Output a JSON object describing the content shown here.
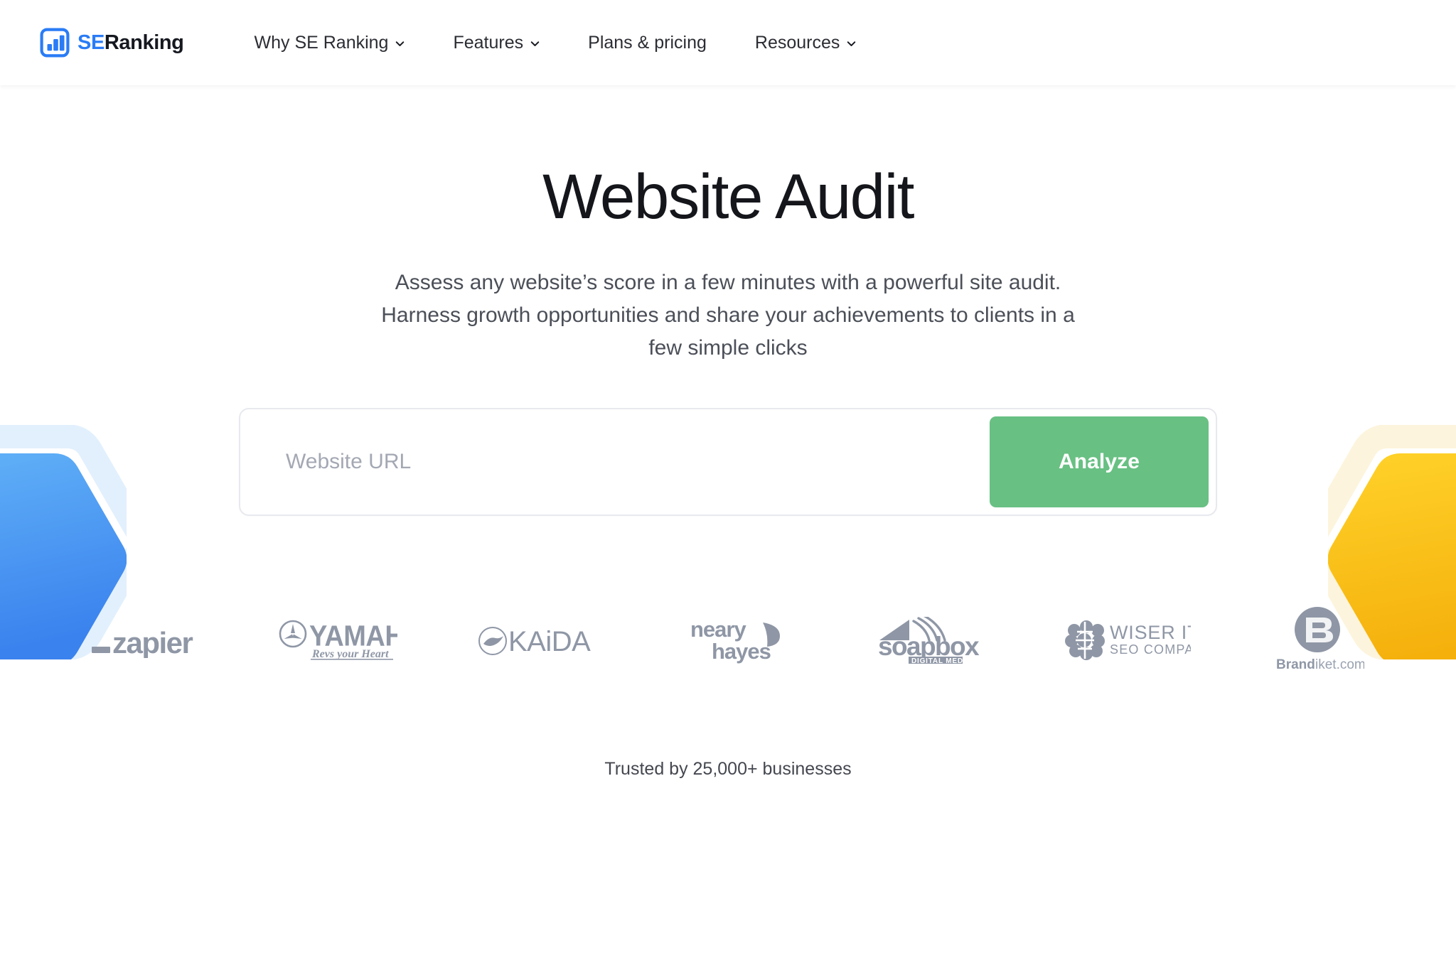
{
  "header": {
    "brand": {
      "icon": "bar-chart-logo-icon",
      "text_primary": "SE",
      "text_secondary": "Ranking",
      "accent_color": "#2a7cf6",
      "text_color": "#15181f"
    },
    "nav": [
      {
        "label": "Why SE Ranking",
        "has_dropdown": true,
        "icon": "chevron-down-icon"
      },
      {
        "label": "Features",
        "has_dropdown": true,
        "icon": "chevron-down-icon"
      },
      {
        "label": "Plans & pricing",
        "has_dropdown": false,
        "icon": ""
      },
      {
        "label": "Resources",
        "has_dropdown": true,
        "icon": "chevron-down-icon"
      }
    ]
  },
  "hero": {
    "title": "Website Audit",
    "subtitle": "Assess any website’s score in a few minutes with a powerful site audit. Harness growth opportunities and share your achievements to clients in a few simple clicks"
  },
  "search": {
    "placeholder": "Website URL",
    "value": "",
    "button_label": "Analyze",
    "button_color": "#68c083",
    "border_color": "#e8e9ef"
  },
  "logos": [
    {
      "name": "zapier",
      "label": "_zapier"
    },
    {
      "name": "yamaha",
      "label": "YAMAHA",
      "tagline": "Revs your Heart"
    },
    {
      "name": "kaida",
      "label": "KAiDA"
    },
    {
      "name": "neary-hayes",
      "label_top": "neary",
      "label_bottom": "hayes"
    },
    {
      "name": "soapbox",
      "label": "soapbox",
      "tagline": "DIGITAL MEDIA"
    },
    {
      "name": "wiser-it",
      "label": "WISER IT",
      "tagline": "SEO COMPANY"
    },
    {
      "name": "brandiket",
      "label_bold": "Brand",
      "label_rest": "iket.com"
    }
  ],
  "trusted": {
    "text": "Trusted by 25,000+ businesses"
  },
  "decor": {
    "left_hexagon": {
      "fill_top": "#5aadf7",
      "fill_bottom": "#3d85ef",
      "halo": "#e2f0fd"
    },
    "right_hexagon": {
      "fill_top": "#ffcf21",
      "fill_bottom": "#f7b612",
      "halo": "#fdf4dd"
    }
  }
}
